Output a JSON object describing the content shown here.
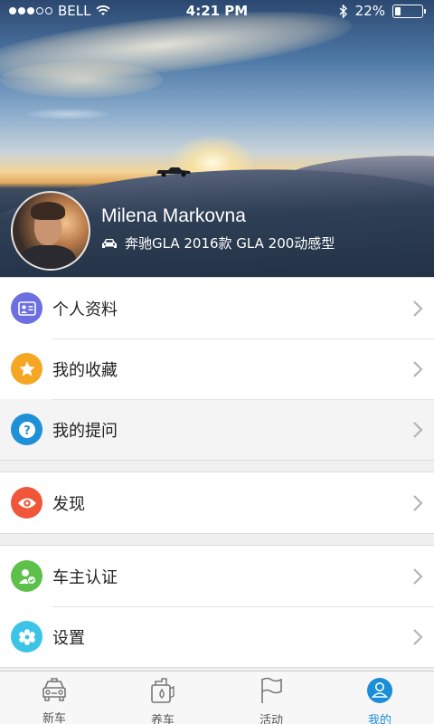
{
  "status_bar": {
    "carrier": "BELL",
    "time": "4:21 PM",
    "battery": "22%",
    "battery_level": 0.22
  },
  "profile": {
    "name": "Milena Markovna",
    "car": "奔驰GLA 2016款 GLA 200动感型"
  },
  "menu": {
    "group1": [
      {
        "label": "个人资料",
        "icon": "profile-card-icon",
        "color": "#6b6fe0"
      },
      {
        "label": "我的收藏",
        "icon": "star-icon",
        "color": "#f5a623"
      },
      {
        "label": "我的提问",
        "icon": "question-icon",
        "color": "#1e90d8"
      }
    ],
    "group2": [
      {
        "label": "发现",
        "icon": "eye-icon",
        "color": "#f0573a"
      }
    ],
    "group3": [
      {
        "label": "车主认证",
        "icon": "user-verified-icon",
        "color": "#5cc04a"
      },
      {
        "label": "设置",
        "icon": "settings-icon",
        "color": "#3cc4e6"
      }
    ]
  },
  "tabbar": {
    "tabs": [
      {
        "label": "新车",
        "icon": "car-front-icon"
      },
      {
        "label": "养车",
        "icon": "oil-can-icon"
      },
      {
        "label": "活动",
        "icon": "flag-icon"
      },
      {
        "label": "我的",
        "icon": "user-circle-icon",
        "active": true
      }
    ],
    "active_color": "#1a8ed8"
  }
}
